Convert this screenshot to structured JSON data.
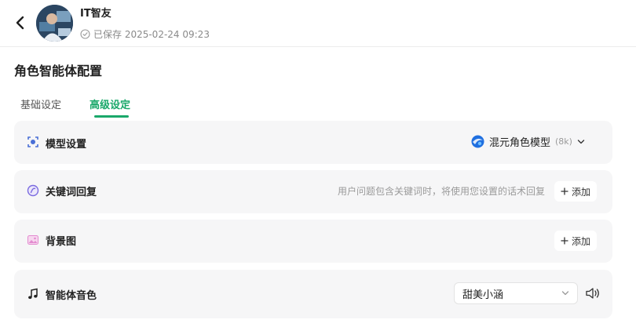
{
  "header": {
    "agent_name": "IT智友",
    "save_status": "已保存 2025-02-24 09:23"
  },
  "page": {
    "title": "角色智能体配置"
  },
  "tabs": [
    {
      "label": "基础设定",
      "active": false
    },
    {
      "label": "高级设定",
      "active": true
    }
  ],
  "settings": {
    "model": {
      "title": "模型设置",
      "icon": "model-icon",
      "selected_model": "混元角色模型",
      "context": "(8k)"
    },
    "keyword_reply": {
      "title": "关键词回复",
      "icon": "keyword-icon",
      "hint": "用户问题包含关键词时，将使用您设置的话术回复",
      "add_label": "添加"
    },
    "background": {
      "title": "背景图",
      "icon": "image-icon",
      "add_label": "添加"
    },
    "voice": {
      "title": "智能体音色",
      "icon": "music-note-icon",
      "selected_voice": "甜美小涵"
    }
  },
  "colors": {
    "accent": "#1aa86a",
    "card_bg": "#f6f6f7"
  }
}
